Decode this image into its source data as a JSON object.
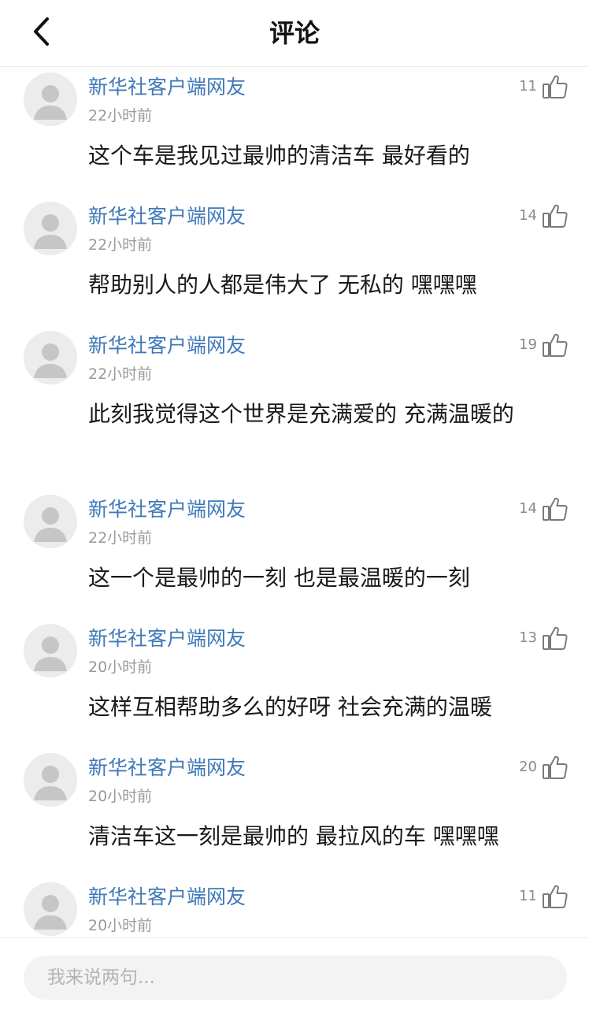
{
  "header": {
    "title": "评论"
  },
  "comments": [
    {
      "user": "新华社客户端网友",
      "time": "22小时前",
      "likes": "11",
      "text": "这个车是我见过最帅的清洁车 最好看的"
    },
    {
      "user": "新华社客户端网友",
      "time": "22小时前",
      "likes": "14",
      "text": "帮助别人的人都是伟大了 无私的 嘿嘿嘿"
    },
    {
      "user": "新华社客户端网友",
      "time": "22小时前",
      "likes": "19",
      "text": "此刻我觉得这个世界是充满爱的 充满温暖的"
    },
    {
      "user": "新华社客户端网友",
      "time": "22小时前",
      "likes": "14",
      "text": "这一个是最帅的一刻 也是最温暖的一刻"
    },
    {
      "user": "新华社客户端网友",
      "time": "20小时前",
      "likes": "13",
      "text": "这样互相帮助多么的好呀 社会充满的温暖"
    },
    {
      "user": "新华社客户端网友",
      "time": "20小时前",
      "likes": "20",
      "text": "清洁车这一刻是最帅的 最拉风的车 嘿嘿嘿"
    },
    {
      "user": "新华社客户端网友",
      "time": "20小时前",
      "likes": "11",
      "text": ""
    }
  ],
  "footer": {
    "placeholder": "我来说两句..."
  }
}
